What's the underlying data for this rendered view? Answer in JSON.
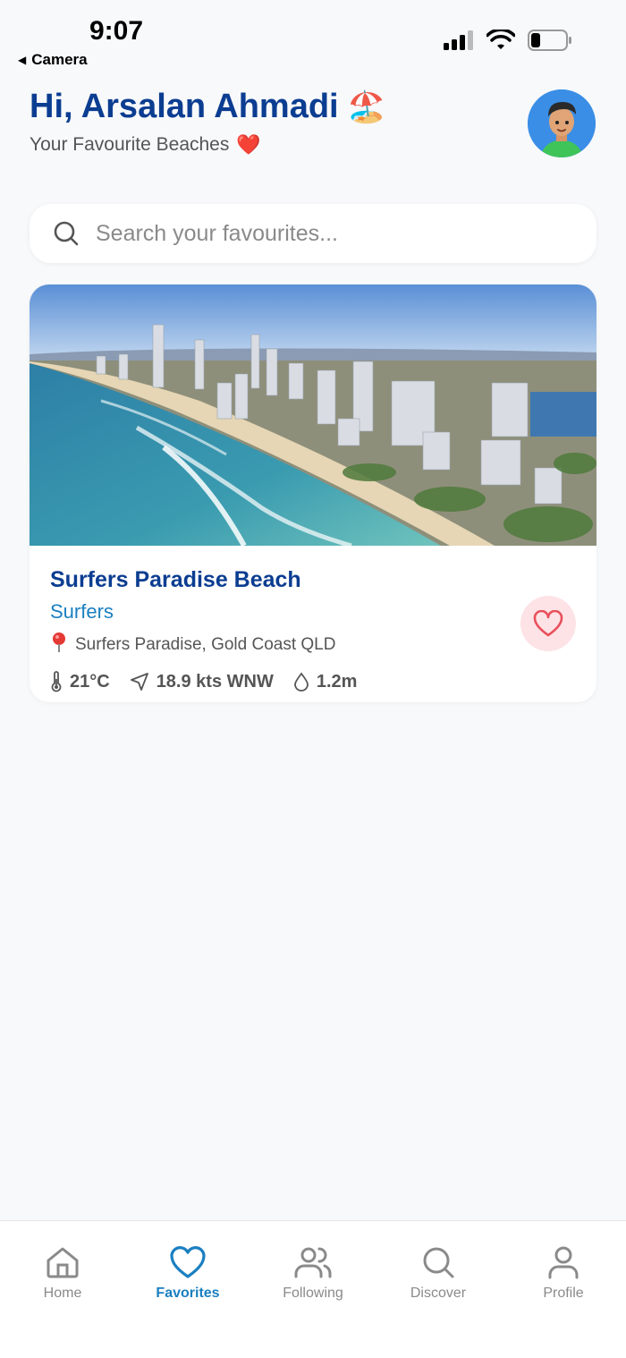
{
  "status_bar": {
    "time": "9:07",
    "back_label": "Camera"
  },
  "header": {
    "greeting": "Hi, Arsalan Ahmadi",
    "greeting_emoji": "🏖️",
    "subtitle": "Your Favourite Beaches",
    "subtitle_emoji": "❤️"
  },
  "search": {
    "placeholder": "Search your favourites..."
  },
  "favorites": [
    {
      "title": "Surfers Paradise Beach",
      "category": "Surfers",
      "location": "Surfers Paradise, Gold Coast QLD",
      "temperature": "21°C",
      "wind": "18.9 kts WNW",
      "swell": "1.2m",
      "favorited": true
    }
  ],
  "tabs": [
    {
      "label": "Home",
      "icon": "home-icon",
      "active": false
    },
    {
      "label": "Favorites",
      "icon": "heart-icon",
      "active": true
    },
    {
      "label": "Following",
      "icon": "users-icon",
      "active": false
    },
    {
      "label": "Discover",
      "icon": "search-icon",
      "active": false
    },
    {
      "label": "Profile",
      "icon": "user-icon",
      "active": false
    }
  ],
  "colors": {
    "brand_blue": "#0b3d91",
    "accent_blue": "#1a7fc1",
    "heart_red": "#e8505b",
    "background": "#f8f9fb"
  }
}
